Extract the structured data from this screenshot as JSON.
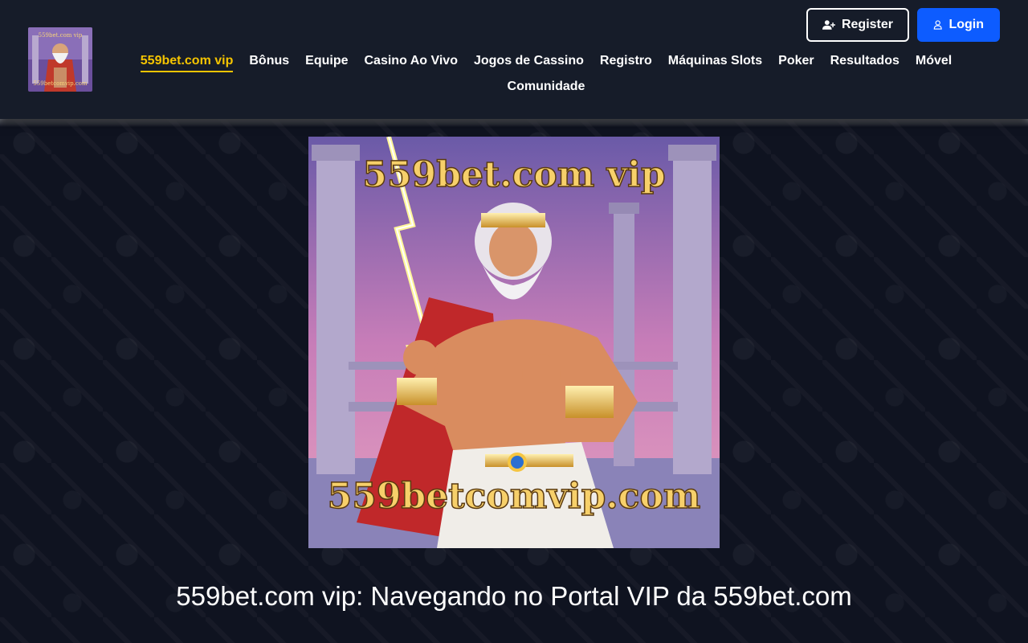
{
  "header": {
    "logo_text": "559betcomvip.com",
    "auth": {
      "register_label": "Register",
      "login_label": "Login"
    },
    "nav": [
      {
        "label": "559bet.com vip",
        "active": true
      },
      {
        "label": "Bônus"
      },
      {
        "label": "Equipe"
      },
      {
        "label": "Casino Ao Vivo"
      },
      {
        "label": "Jogos de Cassino"
      },
      {
        "label": "Registro"
      },
      {
        "label": "Máquinas Slots"
      },
      {
        "label": "Poker"
      },
      {
        "label": "Resultados"
      },
      {
        "label": "Móvel"
      },
      {
        "label": "Comunidade"
      }
    ]
  },
  "hero": {
    "top_text": "559bet.com vip",
    "bottom_text": "559betcomvip.com"
  },
  "main": {
    "title": "559bet.com vip: Navegando no Portal VIP da 559bet.com"
  },
  "colors": {
    "header_bg": "#161c29",
    "page_bg": "#0f1320",
    "accent": "#f5c400",
    "login_blue": "#0d5cff"
  }
}
